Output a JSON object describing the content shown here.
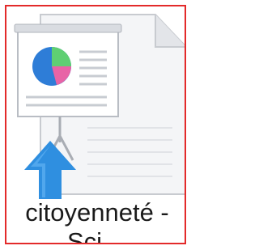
{
  "file": {
    "name_line1": "citoyenneté -",
    "name_line2": "Sci…",
    "selected": true,
    "icon": "presentation-file-icon"
  },
  "colors": {
    "selection_border": "#e32a2a",
    "arrow_blue": "#2f8fe0",
    "pie_blue": "#2e7dd7",
    "pie_green": "#5fcf73",
    "pie_pink": "#e864a6"
  }
}
